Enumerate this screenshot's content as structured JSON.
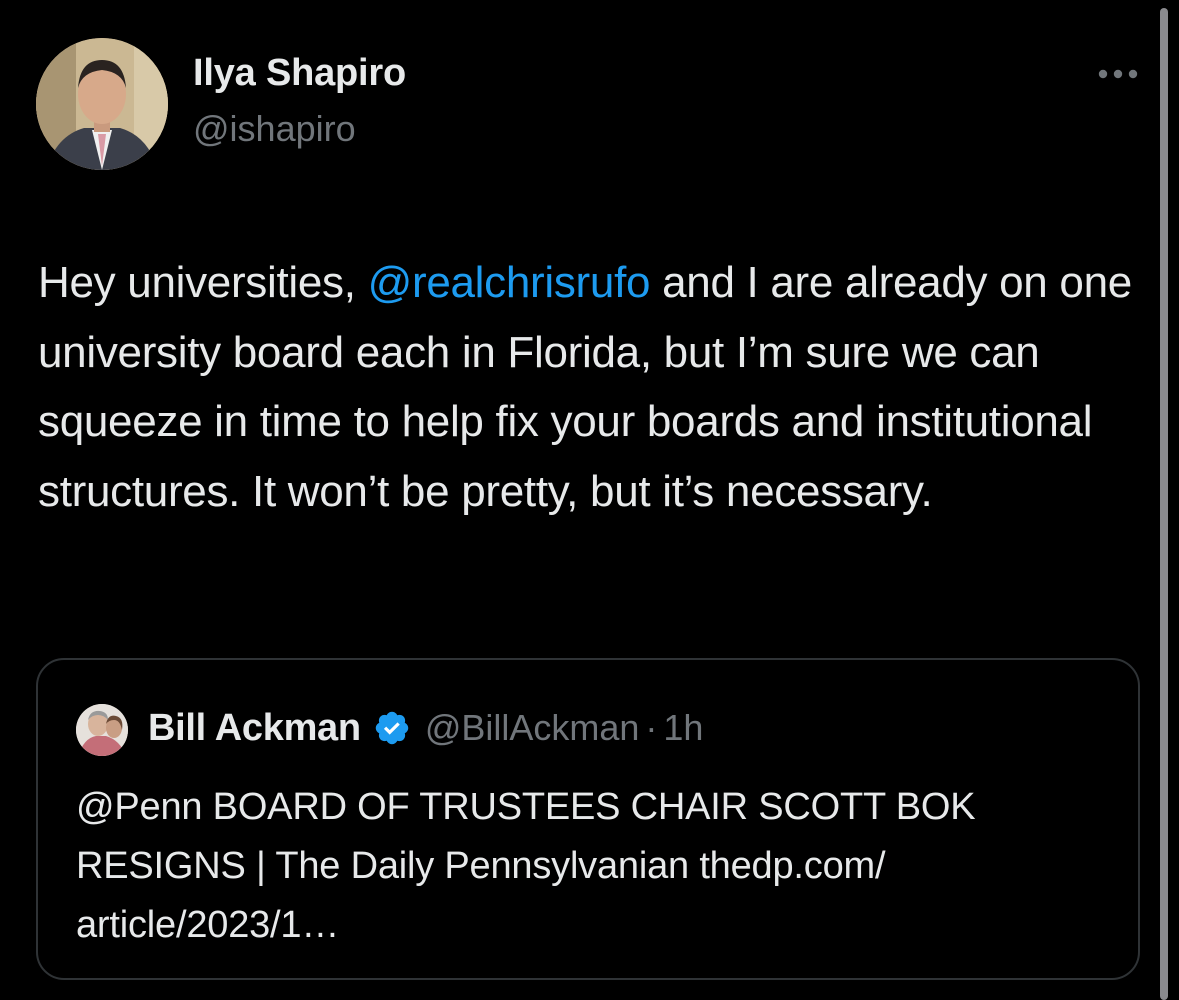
{
  "tweet": {
    "author": {
      "display_name": "Ilya Shapiro",
      "handle": "@ishapiro"
    },
    "more_icon": "more-horizontal-icon",
    "text_before_mention": "Hey universities, ",
    "mention": "@realchrisrufo",
    "text_after_mention": " and I are already on one university board each in Florida, but I’m sure we can squeeze in time to help fix your boards and institutional structures. It won’t be pretty, but it’s necessary.",
    "quoted_tweet": {
      "display_name": "Bill Ackman",
      "verified_icon": "verified-badge-icon",
      "handle": "@BillAckman",
      "separator": "·",
      "time": "1h",
      "text": "@Penn BOARD OF TRUSTEES CHAIR SCOTT BOK RESIGNS | The Daily Pennsylvanian thedp.com/ article/2023/1…"
    }
  },
  "colors": {
    "background": "#000000",
    "primary_text": "#e7e9ea",
    "secondary_text": "#71767b",
    "link": "#1d9bf0",
    "border": "#2f3336",
    "verified": "#1d9bf0"
  }
}
